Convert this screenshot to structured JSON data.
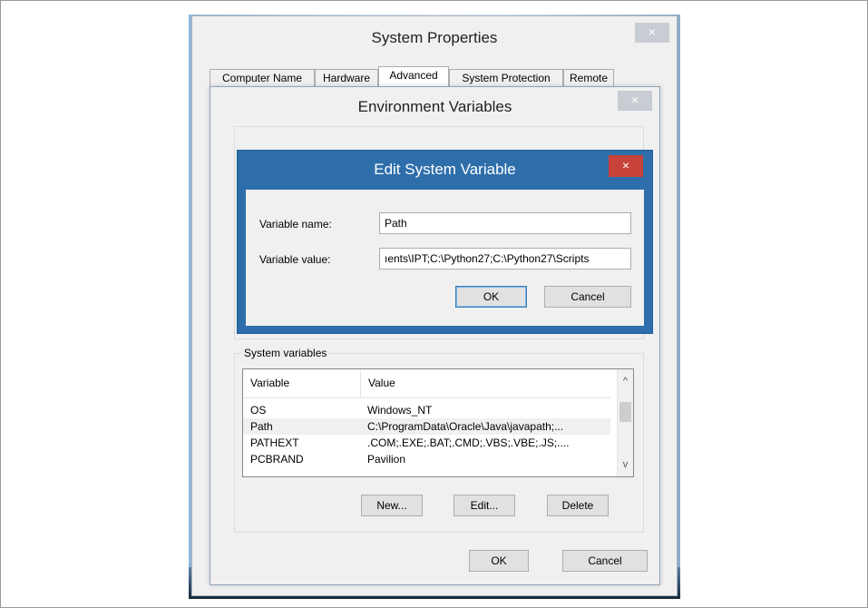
{
  "system_properties": {
    "title": "System Properties",
    "close_glyph": "×",
    "tabs": [
      {
        "label": "Computer Name"
      },
      {
        "label": "Hardware"
      },
      {
        "label": "Advanced"
      },
      {
        "label": "System Protection"
      },
      {
        "label": "Remote"
      }
    ],
    "active_tab": "Advanced"
  },
  "environment_variables": {
    "title": "Environment Variables",
    "close_glyph": "×",
    "system_vars_group_label": "System variables",
    "columns": {
      "variable": "Variable",
      "value": "Value"
    },
    "rows": [
      {
        "variable": "OS",
        "value": "Windows_NT"
      },
      {
        "variable": "Path",
        "value": "C:\\ProgramData\\Oracle\\Java\\javapath;..."
      },
      {
        "variable": "PATHEXT",
        "value": ".COM;.EXE;.BAT;.CMD;.VBS;.VBE;.JS;...."
      },
      {
        "variable": "PCBRAND",
        "value": "Pavilion"
      }
    ],
    "selected_row": "Path",
    "buttons": {
      "new": "New...",
      "edit": "Edit...",
      "delete": "Delete",
      "ok": "OK",
      "cancel": "Cancel"
    },
    "scroll_up_glyph": "^",
    "scroll_down_glyph": "v"
  },
  "edit_system_variable": {
    "title": "Edit System Variable",
    "close_glyph": "×",
    "name_label": "Variable name:",
    "name_value": "Path",
    "value_label": "Variable value:",
    "value_value": "ıents\\IPT;C:\\Python27;C:\\Python27\\Scripts",
    "buttons": {
      "ok": "OK",
      "cancel": "Cancel"
    }
  },
  "colors": {
    "dialog_title_active": "#2e6eaa",
    "close_button_active": "#c7423a",
    "window_background": "#f0f0f0"
  }
}
